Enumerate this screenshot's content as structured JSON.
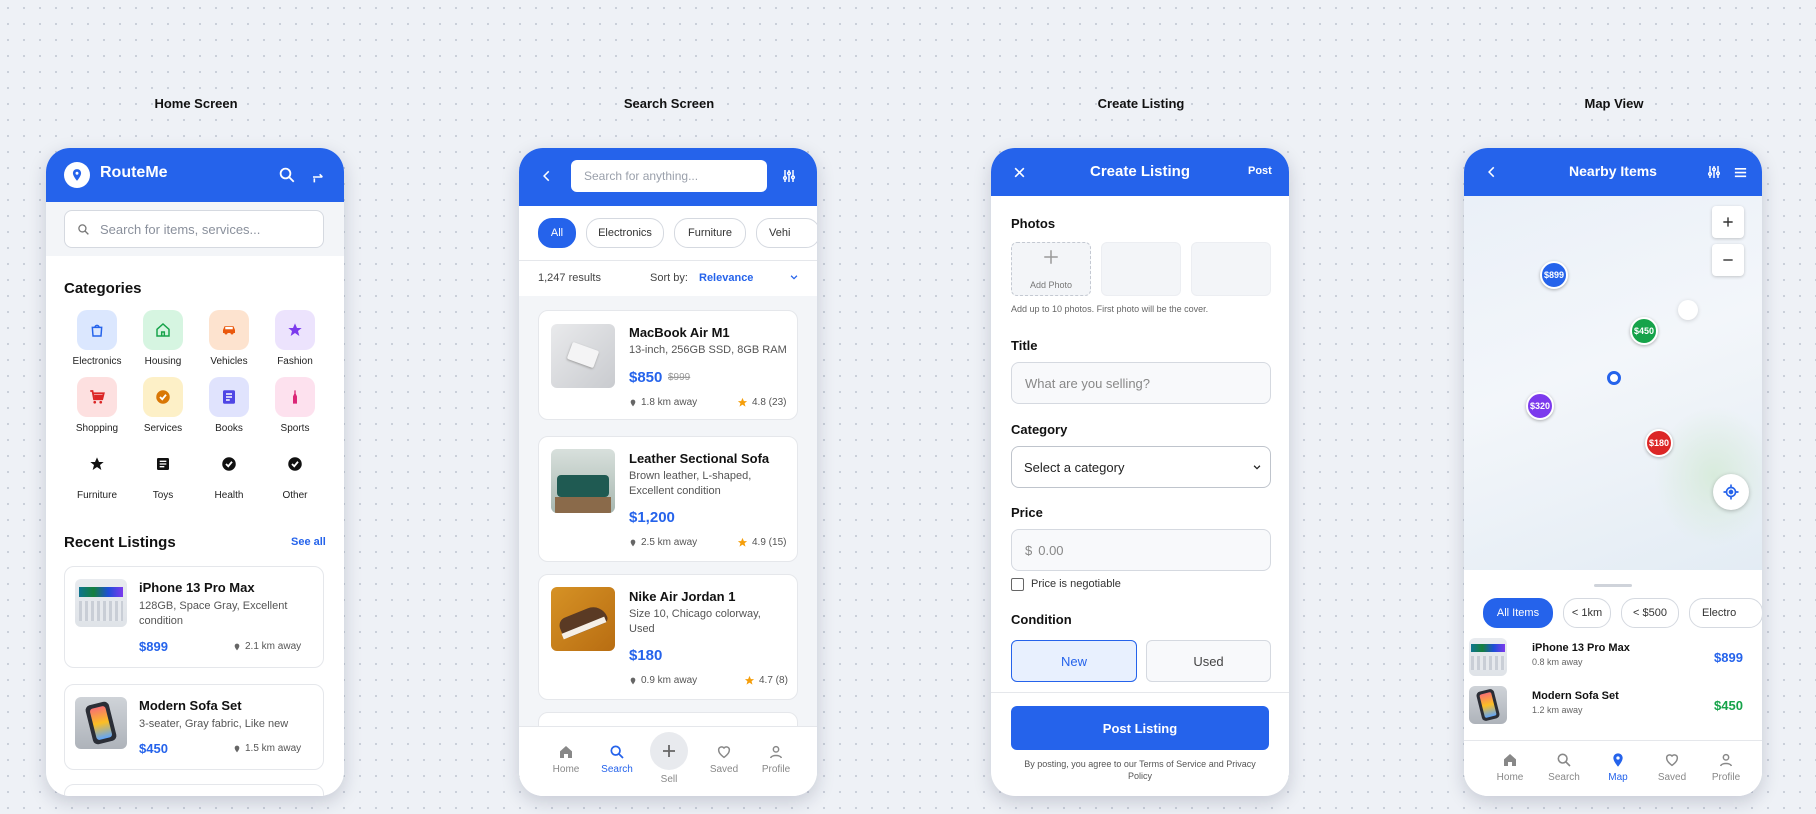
{
  "labels": {
    "home": "Home Screen",
    "search": "Search Screen",
    "create": "Create Listing",
    "map": "Map View"
  },
  "home": {
    "app_name": "RouteMe",
    "search_placeholder": "Search for items, services...",
    "categories_title": "Categories",
    "categories": [
      {
        "label": "Electronics",
        "icon": "shopping-bag-icon",
        "color": "#2563eb",
        "bg": "#dbe7fe"
      },
      {
        "label": "Housing",
        "icon": "house-icon",
        "color": "#16a34a",
        "bg": "#d6f5e1"
      },
      {
        "label": "Vehicles",
        "icon": "car-icon",
        "color": "#ea580c",
        "bg": "#fde3cf"
      },
      {
        "label": "Fashion",
        "icon": "star-icon",
        "color": "#7c3aed",
        "bg": "#ece3fd"
      },
      {
        "label": "Shopping",
        "icon": "cart-icon",
        "color": "#dc2626",
        "bg": "#fde0e0"
      },
      {
        "label": "Services",
        "icon": "check-badge-icon",
        "color": "#d97706",
        "bg": "#fdf0c7"
      },
      {
        "label": "Books",
        "icon": "book-icon",
        "color": "#4f46e5",
        "bg": "#e0e3fd"
      },
      {
        "label": "Sports",
        "icon": "bottle-icon",
        "color": "#db2777",
        "bg": "#fde1ee"
      },
      {
        "label": "Furniture",
        "icon": "star-icon",
        "color": "#111111",
        "bg": ""
      },
      {
        "label": "Toys",
        "icon": "list-icon",
        "color": "#111111",
        "bg": ""
      },
      {
        "label": "Health",
        "icon": "check-circle-icon",
        "color": "#111111",
        "bg": ""
      },
      {
        "label": "Other",
        "icon": "check-circle-icon",
        "color": "#111111",
        "bg": ""
      }
    ],
    "recent_title": "Recent Listings",
    "see_all": "See all",
    "listings": [
      {
        "name": "iPhone 13 Pro Max",
        "desc": "128GB, Space Gray, Excellent condition",
        "price": "$899",
        "distance": "2.1 km away"
      },
      {
        "name": "Modern Sofa Set",
        "desc": "3-seater, Gray fabric, Like new",
        "price": "$450",
        "distance": "1.5 km away"
      }
    ]
  },
  "search": {
    "placeholder": "Search for anything...",
    "chips": [
      "All",
      "Electronics",
      "Furniture",
      "Vehi"
    ],
    "results": "1,247 results",
    "sort_label": "Sort by:",
    "sort_value": "Relevance",
    "items": [
      {
        "name": "MacBook Air M1",
        "desc": "13-inch, 256GB SSD, 8GB RAM",
        "price": "$850",
        "old_price": "$999",
        "distance": "1.8 km away",
        "rating": "4.8 (23)"
      },
      {
        "name": "Leather Sectional Sofa",
        "desc": "Brown leather, L-shaped, Excellent condition",
        "price": "$1,200",
        "old_price": "",
        "distance": "2.5 km away",
        "rating": "4.9 (15)"
      },
      {
        "name": "Nike Air Jordan 1",
        "desc": "Size 10, Chicago colorway, Used",
        "price": "$180",
        "old_price": "",
        "distance": "0.9 km away",
        "rating": "4.7 (8)"
      }
    ],
    "tabs": [
      "Home",
      "Search",
      "Sell",
      "Saved",
      "Profile"
    ]
  },
  "create": {
    "title": "Create Listing",
    "post": "Post",
    "photos_label": "Photos",
    "add_photo": "Add Photo",
    "photos_hint": "Add up to 10 photos. First photo will be the cover.",
    "title_label": "Title",
    "title_placeholder": "What are you selling?",
    "category_label": "Category",
    "category_value": "Select a category",
    "price_label": "Price",
    "currency": "$",
    "price_placeholder": "0.00",
    "negotiable": "Price is negotiable",
    "condition_label": "Condition",
    "cond_new": "New",
    "cond_used": "Used",
    "submit": "Post Listing",
    "terms": "By posting, you agree to our Terms of Service and Privacy Policy"
  },
  "map": {
    "title": "Nearby Items",
    "pins": [
      {
        "label": "$899",
        "color": "#2563eb"
      },
      {
        "label": "$450",
        "color": "#16a34a"
      },
      {
        "label": "$320",
        "color": "#7c3aed"
      },
      {
        "label": "$180",
        "color": "#dc2626"
      }
    ],
    "chips": [
      "All Items",
      "< 1km",
      "< $500",
      "Electro"
    ],
    "items": [
      {
        "name": "iPhone 13 Pro Max",
        "distance": "0.8 km away",
        "price": "$899",
        "price_color": "#2563eb"
      },
      {
        "name": "Modern Sofa Set",
        "distance": "1.2 km away",
        "price": "$450",
        "price_color": "#16a34a"
      }
    ],
    "tabs": [
      "Home",
      "Search",
      "Map",
      "Saved",
      "Profile"
    ]
  }
}
